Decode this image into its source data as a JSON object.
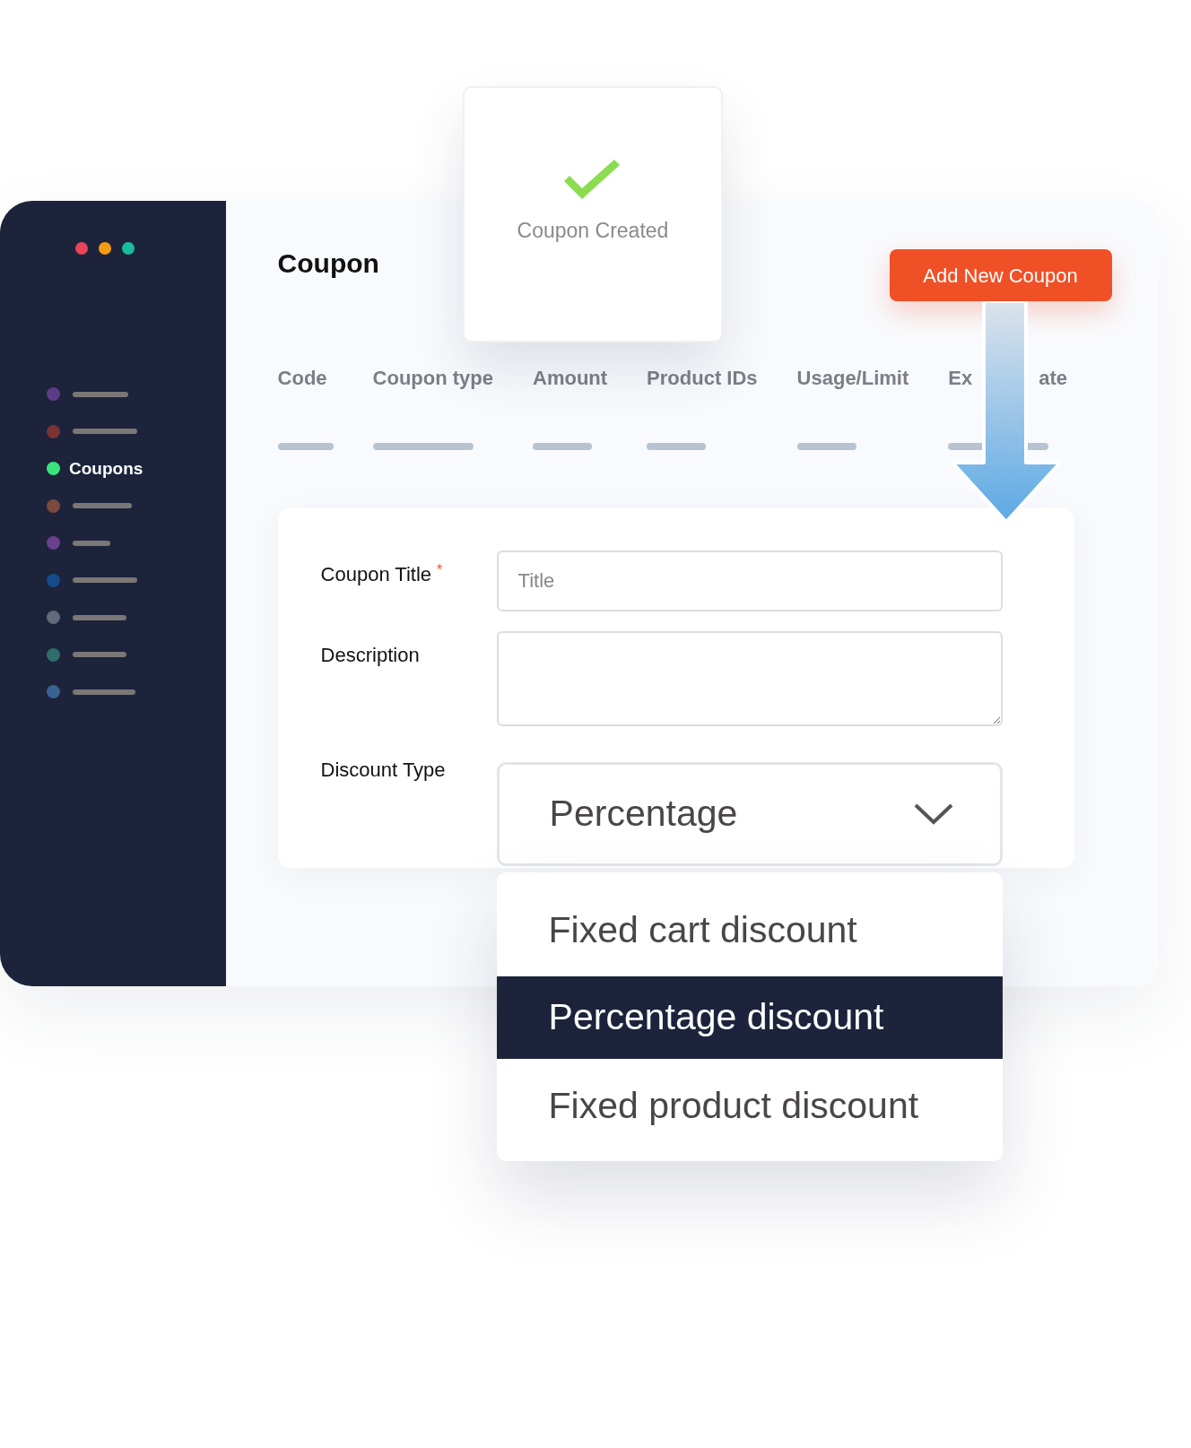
{
  "window": {
    "traffic_lights": [
      {
        "color": "#e8445a"
      },
      {
        "color": "#f39c12"
      },
      {
        "color": "#1abc9c"
      }
    ]
  },
  "sidebar": {
    "items": [
      {
        "color": "#5b3d87",
        "selected": false
      },
      {
        "color": "#7a3335",
        "selected": false
      },
      {
        "color": "#3ae47d",
        "label": "Coupons",
        "selected": true
      },
      {
        "color": "#7b4a3e",
        "selected": false
      },
      {
        "color": "#6a3f8c",
        "selected": false
      },
      {
        "color": "#144b8a",
        "selected": false
      },
      {
        "color": "#5f6b7a",
        "selected": false
      },
      {
        "color": "#2f6e6a",
        "selected": false
      },
      {
        "color": "#3a6391",
        "selected": false
      }
    ]
  },
  "page": {
    "title": "Coupon",
    "add_button": "Add New Coupon"
  },
  "toast": {
    "message": "Coupon Created"
  },
  "table": {
    "columns": [
      {
        "parts": [
          "Code"
        ]
      },
      {
        "parts": [
          "Coupon type"
        ]
      },
      {
        "parts": [
          "Amount"
        ]
      },
      {
        "parts": [
          "Product IDs"
        ]
      },
      {
        "parts": [
          "Usage/Limit"
        ]
      },
      {
        "parts": [
          "Ex",
          "ate"
        ]
      }
    ]
  },
  "form": {
    "fields": [
      {
        "kind": "text",
        "label": "Coupon Title",
        "required_mark": "*",
        "placeholder": "Title"
      },
      {
        "kind": "textarea",
        "label": "Description"
      },
      {
        "kind": "select",
        "label": "Discount Type",
        "value": "Percentage",
        "expanded": true,
        "options": [
          {
            "label": "Fixed cart discount",
            "selected": false
          },
          {
            "label": "Percentage discount",
            "selected": true
          },
          {
            "label": "Fixed product discount",
            "selected": false
          }
        ]
      }
    ]
  }
}
